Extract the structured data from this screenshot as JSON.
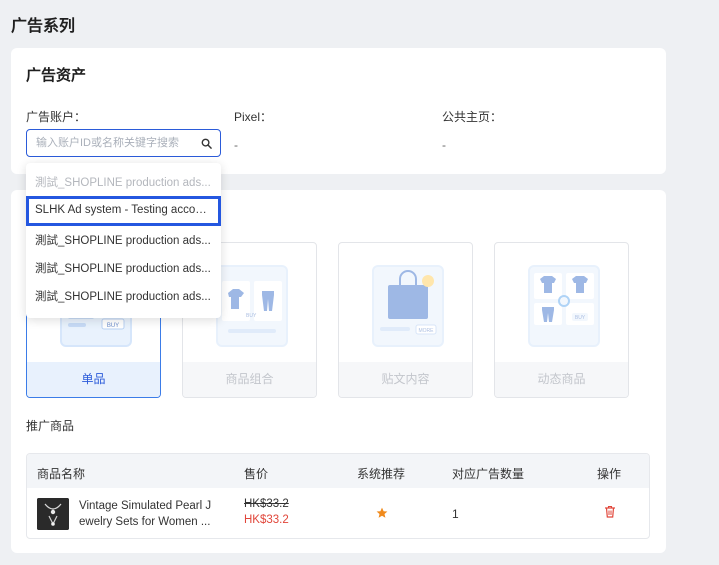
{
  "page": {
    "title": "广告系列"
  },
  "assets": {
    "title": "广告资产",
    "ad_account": {
      "label": "广告账户：",
      "placeholder": "输入账户ID或名称关键字搜索"
    },
    "pixel": {
      "label": "Pixel：",
      "value": "-"
    },
    "public_page": {
      "label": "公共主页：",
      "value": "-"
    }
  },
  "dropdown": {
    "items": [
      {
        "label": "測試_SHOPLINE production ads...",
        "state": "faded"
      },
      {
        "label": "SLHK Ad system - Testing accou...",
        "state": "highlighted"
      },
      {
        "label": "測試_SHOPLINE production ads...",
        "state": "normal"
      },
      {
        "label": "測試_SHOPLINE production ads...",
        "state": "normal"
      },
      {
        "label": "測試_SHOPLINE production ads...",
        "state": "normal"
      }
    ]
  },
  "ad_types": [
    {
      "label": "单品",
      "state": "selected",
      "badge": "BUY"
    },
    {
      "label": "商品组合",
      "state": "disabled",
      "badge": "BUY"
    },
    {
      "label": "贴文内容",
      "state": "disabled",
      "badge": "MORE"
    },
    {
      "label": "动态商品",
      "state": "disabled",
      "badge": "BUY"
    }
  ],
  "products": {
    "title": "推广商品",
    "columns": [
      "商品名称",
      "售价",
      "系统推荐",
      "对应广告数量",
      "操作"
    ],
    "rows": [
      {
        "name": "Vintage Simulated Pearl Jewelry Sets for Women ...",
        "name_line1": "Vintage Simulated Pearl J",
        "name_line2": "ewelry Sets for Women ...",
        "price_original": "HK$33.2",
        "price_sale": "HK$33.2",
        "recommended": true,
        "ad_count": "1"
      }
    ]
  },
  "colors": {
    "accent": "#2b5bd9",
    "highlight_border": "#2457e0",
    "sale_price": "#e1463a",
    "star": "#f08a1c",
    "delete": "#e1463a"
  },
  "icons": [
    "search-icon",
    "star-icon",
    "trash-icon"
  ]
}
